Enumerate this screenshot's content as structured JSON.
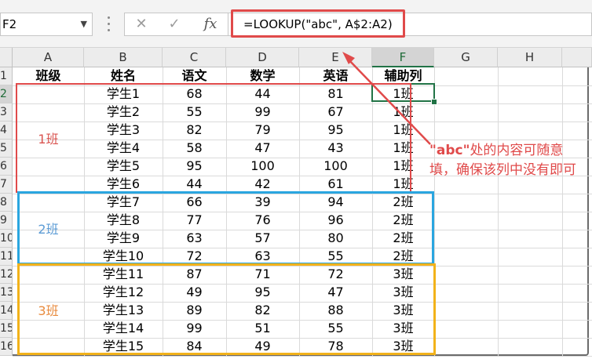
{
  "name_box": {
    "value": "F2"
  },
  "formula_bar": {
    "cancel_icon": "close-icon",
    "enter_icon": "check-icon",
    "fx_label": "fx",
    "formula": "=LOOKUP(\"abc\", A$2:A2)"
  },
  "columns": [
    "A",
    "B",
    "C",
    "D",
    "E",
    "F",
    "G",
    "H"
  ],
  "rows": [
    "1",
    "2",
    "3",
    "4",
    "5",
    "6",
    "7",
    "8",
    "9",
    "10",
    "11",
    "12",
    "13",
    "14",
    "15",
    "16"
  ],
  "headers": [
    "班级",
    "姓名",
    "语文",
    "数学",
    "英语",
    "辅助列"
  ],
  "students": [
    {
      "name": "学生1",
      "chinese": "68",
      "math": "44",
      "english": "81",
      "aux": "1班"
    },
    {
      "name": "学生2",
      "chinese": "55",
      "math": "99",
      "english": "67",
      "aux": "1班"
    },
    {
      "name": "学生3",
      "chinese": "82",
      "math": "79",
      "english": "95",
      "aux": "1班"
    },
    {
      "name": "学生4",
      "chinese": "58",
      "math": "47",
      "english": "43",
      "aux": "1班"
    },
    {
      "name": "学生5",
      "chinese": "95",
      "math": "100",
      "english": "100",
      "aux": "1班"
    },
    {
      "name": "学生6",
      "chinese": "44",
      "math": "42",
      "english": "61",
      "aux": "1班"
    },
    {
      "name": "学生7",
      "chinese": "66",
      "math": "39",
      "english": "94",
      "aux": "2班"
    },
    {
      "name": "学生8",
      "chinese": "77",
      "math": "76",
      "english": "96",
      "aux": "2班"
    },
    {
      "name": "学生9",
      "chinese": "63",
      "math": "57",
      "english": "80",
      "aux": "2班"
    },
    {
      "name": "学生10",
      "chinese": "72",
      "math": "63",
      "english": "55",
      "aux": "2班"
    },
    {
      "name": "学生11",
      "chinese": "87",
      "math": "71",
      "english": "72",
      "aux": "3班"
    },
    {
      "name": "学生12",
      "chinese": "49",
      "math": "95",
      "english": "47",
      "aux": "3班"
    },
    {
      "name": "学生13",
      "chinese": "89",
      "math": "82",
      "english": "88",
      "aux": "3班"
    },
    {
      "name": "学生14",
      "chinese": "99",
      "math": "51",
      "english": "55",
      "aux": "3班"
    },
    {
      "name": "学生15",
      "chinese": "84",
      "math": "49",
      "english": "78",
      "aux": "3班"
    }
  ],
  "groups": [
    {
      "label": "1班",
      "color": "#e04a4a"
    },
    {
      "label": "2班",
      "color": "#2aa6e0"
    },
    {
      "label": "3班",
      "color": "#f2b21a"
    }
  ],
  "group_label_colors": [
    "#d9534f",
    "#5b9bd5",
    "#e88a3c"
  ],
  "annotation": {
    "highlight": "\"abc\"",
    "text": "处的内容可随意填，确保该列中没有即可",
    "color": "#e04a4a"
  }
}
